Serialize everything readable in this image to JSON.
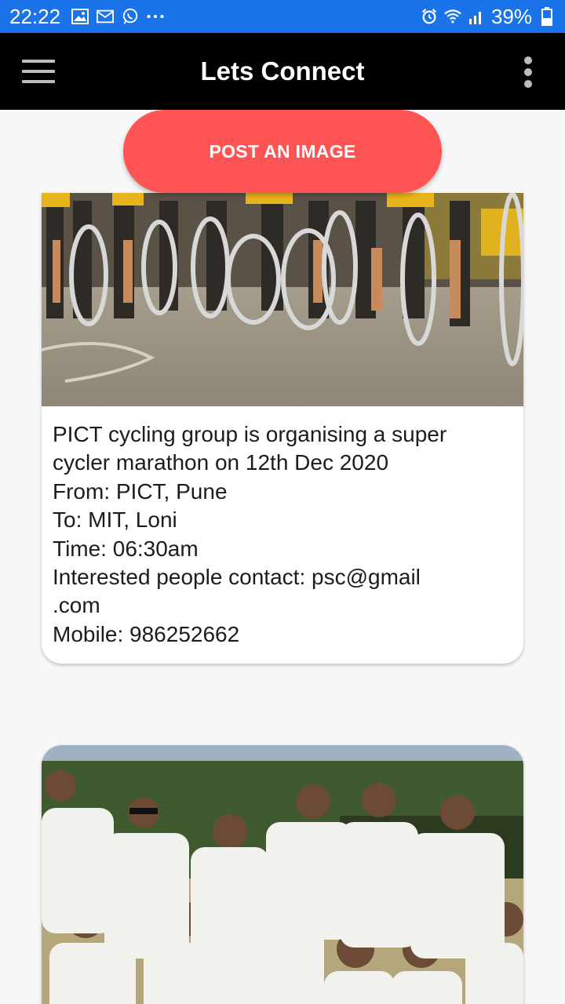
{
  "status_bar": {
    "time": "22:22",
    "battery": "39%",
    "icons_left": [
      "image-icon",
      "mail-icon",
      "whatsapp-icon",
      "more-dots-icon"
    ],
    "icons_right": [
      "alarm-icon",
      "wifi-icon",
      "signal-icon",
      "battery-icon"
    ]
  },
  "app_bar": {
    "title": "Lets Connect"
  },
  "actions": {
    "post_image_label": "POST AN IMAGE"
  },
  "posts": [
    {
      "image": "group-of-cyclists-with-bicycles-photo",
      "lines": [
        "PICT cycling group is organising a super",
        "cycler marathon on 12th Dec 2020",
        "From: PICT, Pune",
        "To: MIT, Loni",
        "Time: 06:30am",
        "Interested people contact: psc@gmail",
        ".com",
        "Mobile: 986252662"
      ]
    },
    {
      "image": "cricket-team-group-photo",
      "lines": []
    }
  ],
  "colors": {
    "status_bar": "#1a73e8",
    "app_bar": "#000000",
    "accent_button": "#ff5454",
    "background": "#f7f7f7"
  }
}
